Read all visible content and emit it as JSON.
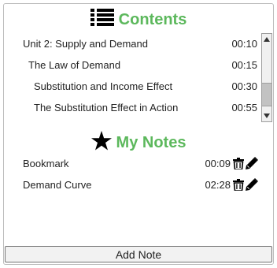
{
  "contents": {
    "title": "Contents",
    "icon": "list-icon",
    "items": [
      {
        "title": "Unit 2: Supply and Demand",
        "time": "00:10",
        "level": 0
      },
      {
        "title": "The Law of Demand",
        "time": "00:15",
        "level": 1
      },
      {
        "title": "Substitution and Income Effect",
        "time": "00:30",
        "level": 2
      },
      {
        "title": "The Substitution Effect in Action",
        "time": "00:55",
        "level": 2
      }
    ]
  },
  "notes": {
    "title": "My Notes",
    "icon": "star-icon",
    "items": [
      {
        "title": "Bookmark",
        "time": "00:09"
      },
      {
        "title": "Demand Curve",
        "time": "02:28"
      }
    ]
  },
  "add_note_label": "Add Note",
  "colors": {
    "accent": "#5cb85c"
  }
}
